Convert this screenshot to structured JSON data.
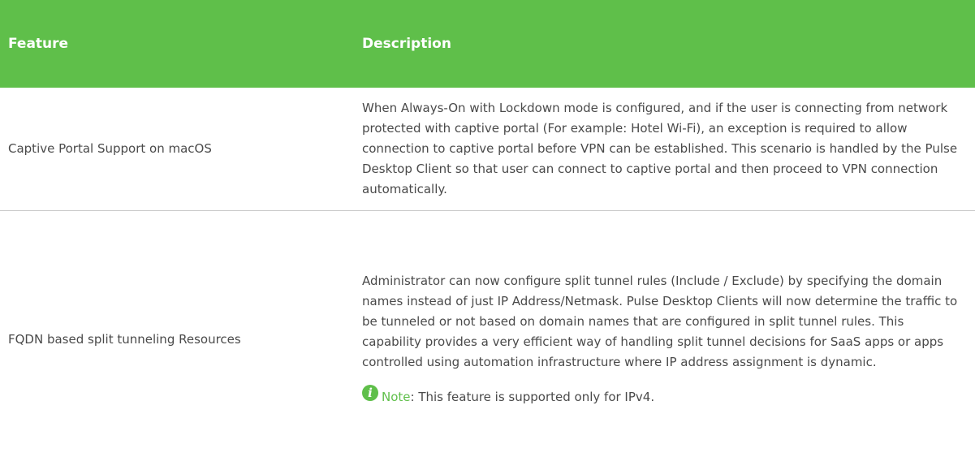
{
  "table": {
    "headers": {
      "feature": "Feature",
      "description": "Description"
    },
    "rows": [
      {
        "feature": "Captive Portal Support on macOS",
        "description": "When Always-On with Lockdown mode is configured, and if the user is connecting from network protected with captive portal (For example: Hotel Wi-Fi), an exception is required to allow connection to captive portal before VPN can be established. This scenario is handled by the Pulse Desktop Client so that user can connect to captive portal and then proceed to VPN connection automatically."
      },
      {
        "feature": "FQDN based split tunneling Resources",
        "description": "Administrator can now configure split tunnel rules (Include / Exclude) by specifying the domain names instead of just IP Address/Netmask. Pulse Desktop Clients will now determine the traffic to be tunneled or not based on domain names that are configured in split tunnel rules. This capability provides a very efficient way of handling split tunnel decisions for SaaS apps or apps controlled using automation infrastructure where IP address assignment is dynamic.",
        "note_label": "Note",
        "note_text": ": This feature is supported only for IPv4."
      }
    ]
  },
  "icons": {
    "note_icon": "info-icon",
    "note_glyph": "i"
  },
  "colors": {
    "header_bg": "#5fbf4a",
    "note_accent": "#5fbf4a"
  }
}
